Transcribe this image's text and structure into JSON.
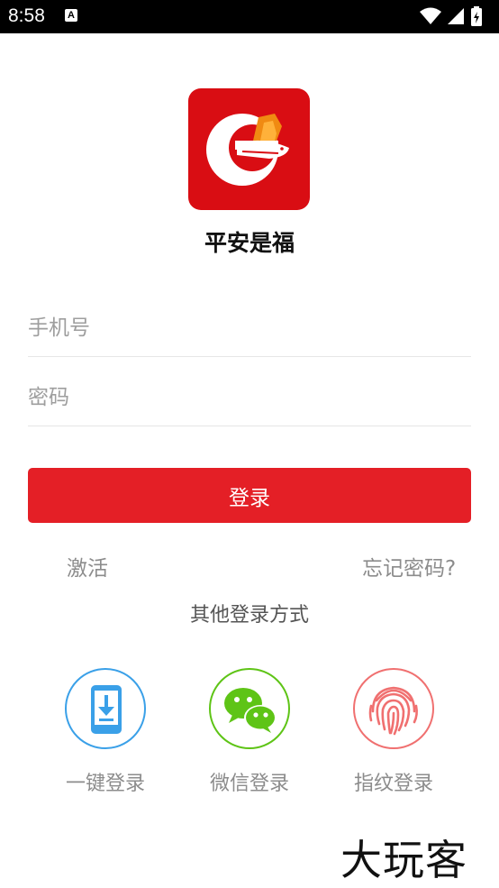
{
  "status_bar": {
    "time": "8:58",
    "notification_icon": "a-icon",
    "icons": [
      "wifi-icon",
      "cell-signal-icon",
      "battery-charging-icon"
    ]
  },
  "app": {
    "logo_icon": "app-logo-icon",
    "name": "平安是福"
  },
  "form": {
    "phone_placeholder": "手机号",
    "phone_value": "",
    "password_placeholder": "密码",
    "password_value": "",
    "login_label": "登录"
  },
  "links": {
    "activate": "激活",
    "forgot_password": "忘记密码?"
  },
  "other_login": {
    "title": "其他登录方式",
    "options": [
      {
        "label": "一键登录",
        "icon": "phone-download-icon",
        "color": "#3aa0e8"
      },
      {
        "label": "微信登录",
        "icon": "wechat-icon",
        "color": "#5ec416"
      },
      {
        "label": "指纹登录",
        "icon": "fingerprint-icon",
        "color": "#f07070"
      }
    ]
  },
  "watermark": "大玩客",
  "colors": {
    "accent": "#e41f26",
    "status_bar": "#000000"
  }
}
